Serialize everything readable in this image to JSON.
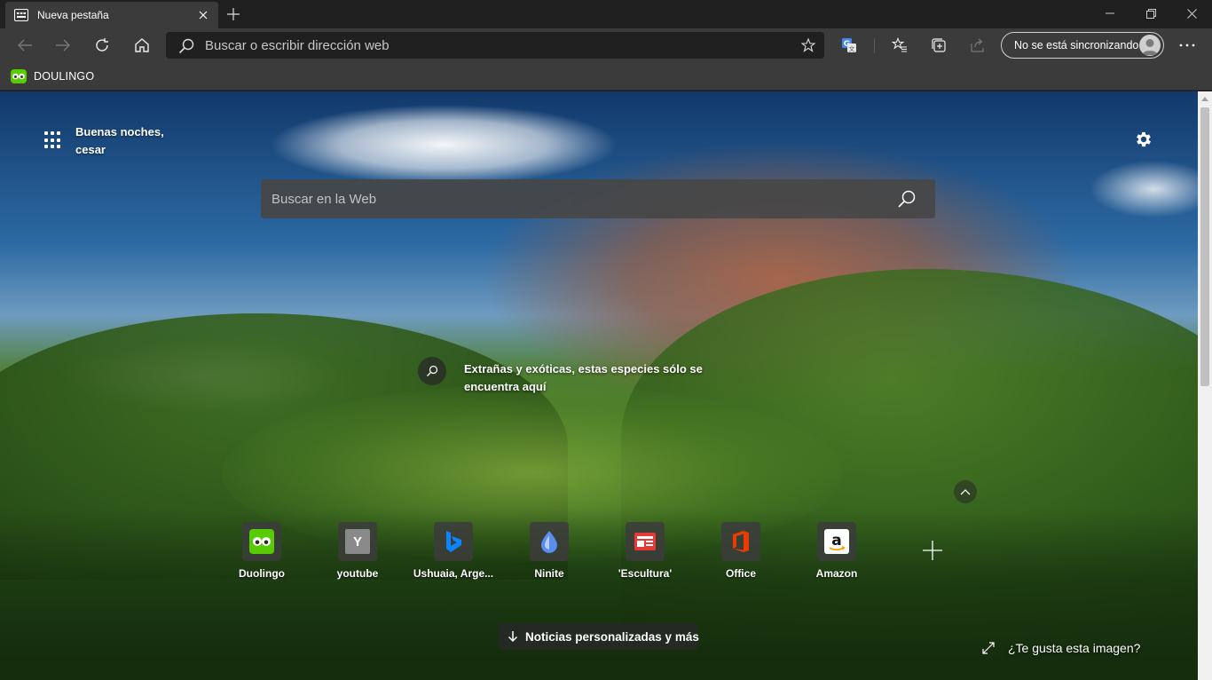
{
  "tab": {
    "title": "Nueva pestaña"
  },
  "addressbar": {
    "placeholder": "Buscar o escribir dirección web"
  },
  "profile": {
    "label": "No se está sincronizando"
  },
  "favorites": [
    {
      "label": "DOULINGO"
    }
  ],
  "greeting": {
    "line1": "Buenas noches,",
    "line2": "cesar"
  },
  "web_search": {
    "placeholder": "Buscar en la Web"
  },
  "image_info": {
    "text": "Extrañas y exóticas, estas especies sólo se encuentra aquí"
  },
  "quick_links": [
    {
      "label": "Duolingo"
    },
    {
      "label": "youtube",
      "letter": "Y"
    },
    {
      "label": "Ushuaia, Arge..."
    },
    {
      "label": "Ninite"
    },
    {
      "label": "'Escultura'"
    },
    {
      "label": "Office"
    },
    {
      "label": "Amazon"
    }
  ],
  "news_button": {
    "label": "Noticias personalizadas y más"
  },
  "like_image": {
    "label": "¿Te gusta esta imagen?"
  },
  "colors": {
    "accent_duolingo": "#58cc02",
    "office": "#d83b01",
    "bing": "#0078d4"
  }
}
